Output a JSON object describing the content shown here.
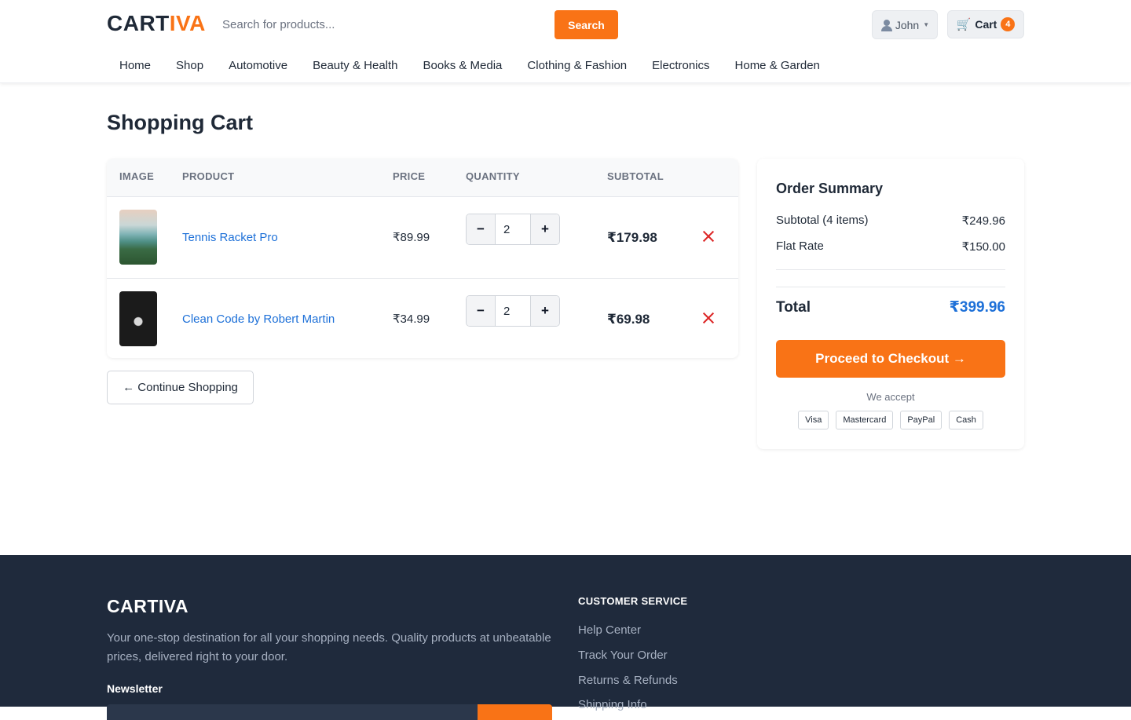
{
  "header": {
    "logo_main": "CART",
    "logo_accent": "IVA",
    "search_placeholder": "Search for products...",
    "search_button": "Search",
    "user_name": "John",
    "cart_label": "Cart",
    "cart_count": "4"
  },
  "nav": {
    "items": [
      "Home",
      "Shop",
      "Automotive",
      "Beauty & Health",
      "Books & Media",
      "Clothing & Fashion",
      "Electronics",
      "Home & Garden"
    ]
  },
  "page": {
    "title": "Shopping Cart"
  },
  "cart": {
    "headers": {
      "image": "IMAGE",
      "product": "PRODUCT",
      "price": "PRICE",
      "quantity": "QUANTITY",
      "subtotal": "SUBTOTAL"
    },
    "items": [
      {
        "name": "Tennis Racket Pro",
        "price": "₹89.99",
        "quantity": "2",
        "subtotal": "₹179.98"
      },
      {
        "name": "Clean Code by Robert Martin",
        "price": "₹34.99",
        "quantity": "2",
        "subtotal": "₹69.98"
      }
    ],
    "continue_label": "← Continue Shopping"
  },
  "summary": {
    "title": "Order Summary",
    "subtotal_label": "Subtotal (4 items)",
    "subtotal_value": "₹249.96",
    "shipping_label": "Flat Rate",
    "shipping_value": "₹150.00",
    "total_label": "Total",
    "total_value": "₹399.96",
    "checkout_label": "Proceed to Checkout →",
    "we_accept": "We accept",
    "payment_methods": [
      "Visa",
      "Mastercard",
      "PayPal",
      "Cash"
    ]
  },
  "footer": {
    "logo": "CARTIVA",
    "description": "Your one-stop destination for all your shopping needs. Quality products at unbeatable prices, delivered right to your door.",
    "newsletter": "Newsletter",
    "customer_service_title": "CUSTOMER SERVICE",
    "links": [
      "Help Center",
      "Track Your Order",
      "Returns & Refunds",
      "Shipping Info"
    ]
  },
  "colors": {
    "accent": "#f97316",
    "link": "#1d70d8",
    "danger": "#dc2626",
    "footer_bg": "#1f2a3c"
  }
}
